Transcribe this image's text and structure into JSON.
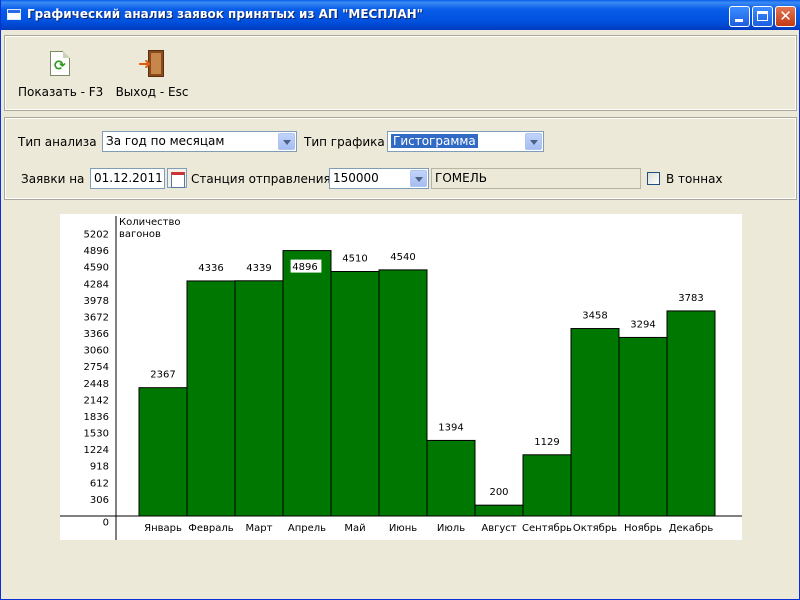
{
  "window": {
    "title": "Графический анализ заявок принятых из АП \"МЕСПЛАН\"",
    "close_glyph": "✕"
  },
  "toolbar": {
    "show_label": "Показать - F3",
    "exit_label": "Выход - Esc",
    "show_icon": "refresh-document-icon",
    "exit_icon": "exit-door-icon"
  },
  "filters": {
    "analysis_type_label": "Тип анализа",
    "analysis_type_value": "За год по месяцам",
    "chart_type_label": "Тип графика",
    "chart_type_value": "Гистограмма",
    "requests_on_label": "Заявки на",
    "date_value": "01.12.2011",
    "station_label": "Станция отправления:",
    "station_code": "150000",
    "station_name": "ГОМЕЛЬ",
    "tons_label": "В тоннах",
    "tons_checked": false
  },
  "colors": {
    "bar_fill": "#007700",
    "title_bar": "#0a5ee8",
    "highlight": "#316ac5"
  },
  "chart_data": {
    "type": "bar",
    "ylabel": "Количество вагонов",
    "categories": [
      "Январь",
      "Февраль",
      "Март",
      "Апрель",
      "Май",
      "Июнь",
      "Июль",
      "Август",
      "Сентябрь",
      "Октябрь",
      "Ноябрь",
      "Декабрь"
    ],
    "values": [
      2367,
      4336,
      4339,
      4896,
      4510,
      4540,
      1394,
      200,
      1129,
      3458,
      3294,
      3783
    ],
    "yticks": [
      0,
      306,
      612,
      918,
      1224,
      1530,
      1836,
      2142,
      2448,
      2754,
      3060,
      3366,
      3672,
      3978,
      4284,
      4590,
      4896,
      5202
    ],
    "ylim": [
      0,
      5202
    ],
    "grid": false,
    "legend": "none"
  }
}
